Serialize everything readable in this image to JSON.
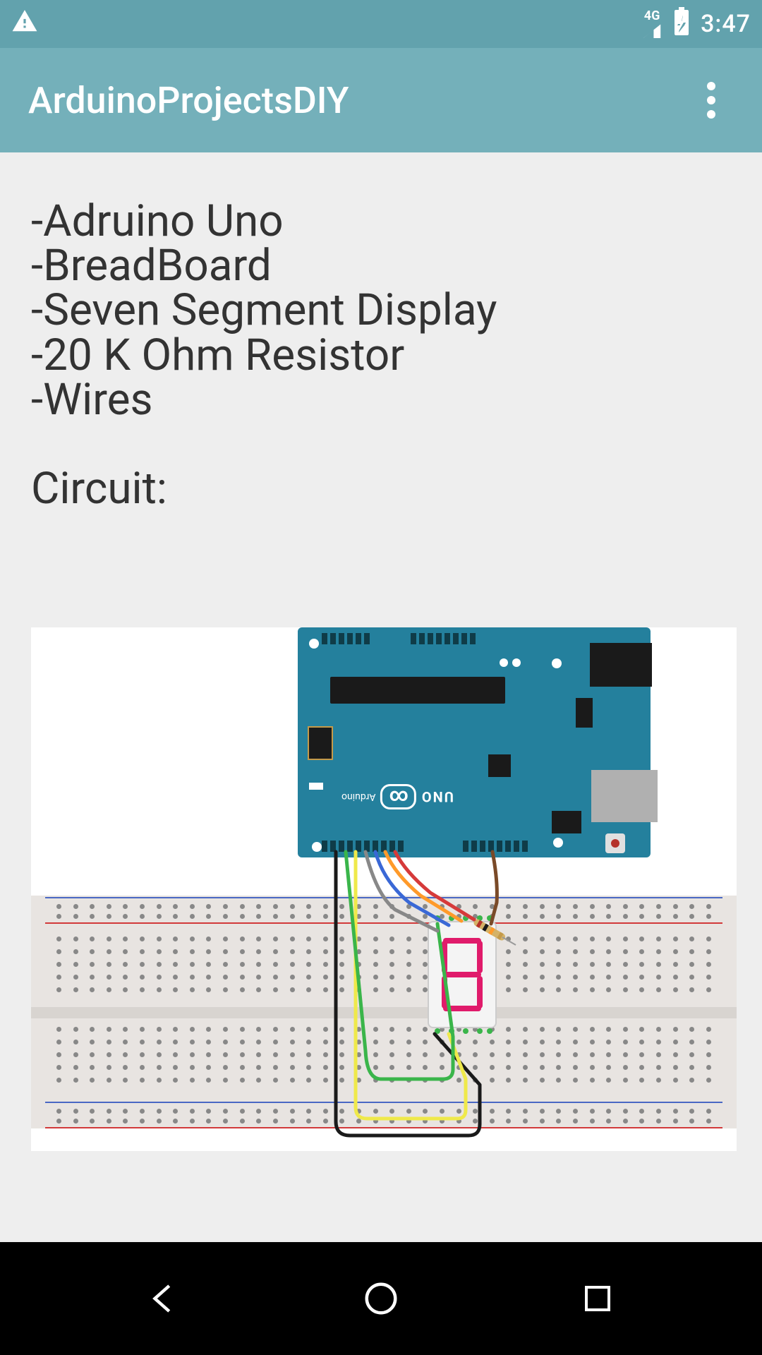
{
  "status_bar": {
    "signal_label": "4G",
    "time": "3:47"
  },
  "app_bar": {
    "title": "ArduinoProjectsDIY"
  },
  "content": {
    "materials": [
      "-Adruino Uno",
      "-BreadBoard",
      "-Seven Segment Display",
      "-20 K Ohm Resistor",
      "-Wires"
    ],
    "circuit_label": "Circuit:"
  },
  "diagram": {
    "board_text": {
      "uno": "UNO",
      "brand": "Arduino"
    },
    "seven_seg_digit": "8",
    "wire_colors": {
      "d2": "#7a4a28",
      "d3": "#d63a3a",
      "d4": "#ff9a2a",
      "d5": "#3a68d6",
      "d6": "#888888",
      "d7": "#efe94a",
      "d8": "#3ab54a",
      "d9": "#1a1a1a"
    }
  },
  "colors": {
    "status_bg": "#62a2ad",
    "appbar_bg": "#74b0ba",
    "arduino_bg": "#24809d",
    "breadboard_bg": "#e8e4e1",
    "seg_color": "#e01b6b"
  }
}
